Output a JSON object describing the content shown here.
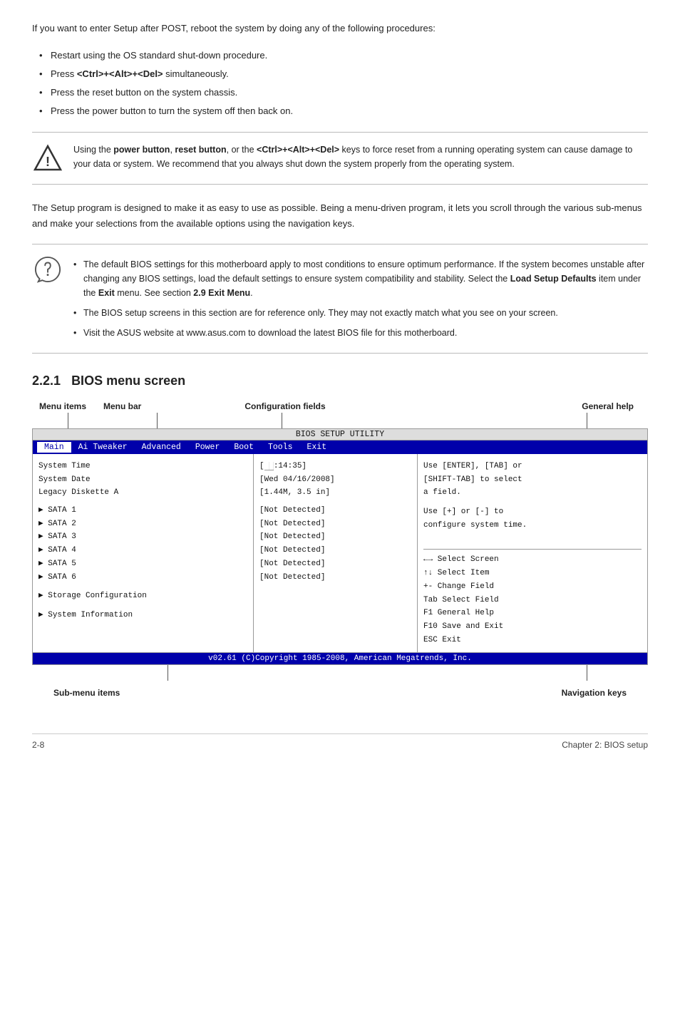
{
  "intro": {
    "paragraph": "If you want to enter Setup after POST, reboot the system by doing any of the following procedures:",
    "bullets": [
      "Restart using the OS standard shut-down procedure.",
      "Press <Ctrl>+<Alt>+<Del> simultaneously.",
      "Press the reset button on the system chassis.",
      "Press the power button to turn the system off then back on."
    ]
  },
  "warning": {
    "text_parts": [
      "Using the ",
      "power button",
      ", ",
      "reset button",
      ", or the ",
      "<Ctrl>+<Alt>+<Del>",
      " keys to force reset from a running operating system can cause damage to your data or system. We recommend that you always shut down the system properly from the operating system."
    ]
  },
  "body_para": "The Setup program is designed to make it as easy to use as possible. Being a menu-driven program, it lets you scroll through the various sub-menus and make your selections from the available options using the navigation keys.",
  "notes": [
    "The default BIOS settings for this motherboard apply to most conditions to ensure optimum performance. If the system becomes unstable after changing any BIOS settings, load the default settings to ensure system compatibility and stability. Select the Load Setup Defaults item under the Exit menu. See section 2.9 Exit Menu.",
    "The BIOS setup screens in this section are for reference only. They may not exactly match what you see on your screen.",
    "Visit the ASUS website at www.asus.com to download the latest BIOS file for this motherboard."
  ],
  "section": {
    "number": "2.2.1",
    "title": "BIOS menu screen"
  },
  "diagram": {
    "top_labels": {
      "menu_items": "Menu items",
      "menu_bar": "Menu bar",
      "config_fields": "Configuration fields",
      "general_help": "General help"
    },
    "bios_title": "BIOS SETUP UTILITY",
    "menu_bar": [
      "Main",
      "Ai Tweaker",
      "Advanced",
      "Power",
      "Boot",
      "Tools",
      "Exit"
    ],
    "active_tab": "Main",
    "left_items": [
      "System Time",
      "System Date",
      "Legacy Diskette A",
      "",
      "▶ SATA 1",
      "▶ SATA 2",
      "▶ SATA 3",
      "▶ SATA 4",
      "▶ SATA 5",
      "▶ SATA 6",
      "",
      "▶ Storage Configuration",
      "",
      "▶ System Information"
    ],
    "center_items": [
      "[██:14:35]",
      "[Wed 04/16/2008]",
      "[1.44M, 3.5 in]",
      "",
      "[Not Detected]",
      "[Not Detected]",
      "[Not Detected]",
      "[Not Detected]",
      "[Not Detected]",
      "[Not Detected]"
    ],
    "right_help_top": [
      "Use [ENTER], [TAB] or",
      "[SHIFT-TAB] to select",
      "a field.",
      "",
      "Use [+] or [-] to",
      "configure system time."
    ],
    "right_help_nav": [
      "←→   Select Screen",
      "↑↓   Select Item",
      "+-   Change Field",
      "Tab  Select Field",
      "F1   General Help",
      "F10  Save and Exit",
      "ESC  Exit"
    ],
    "footer": "v02.61 (C)Copyright 1985-2008, American Megatrends, Inc.",
    "bottom_labels": {
      "sub_menu": "Sub-menu items",
      "nav_keys": "Navigation keys"
    }
  },
  "page_footer": {
    "left": "2-8",
    "right": "Chapter 2: BIOS setup"
  }
}
